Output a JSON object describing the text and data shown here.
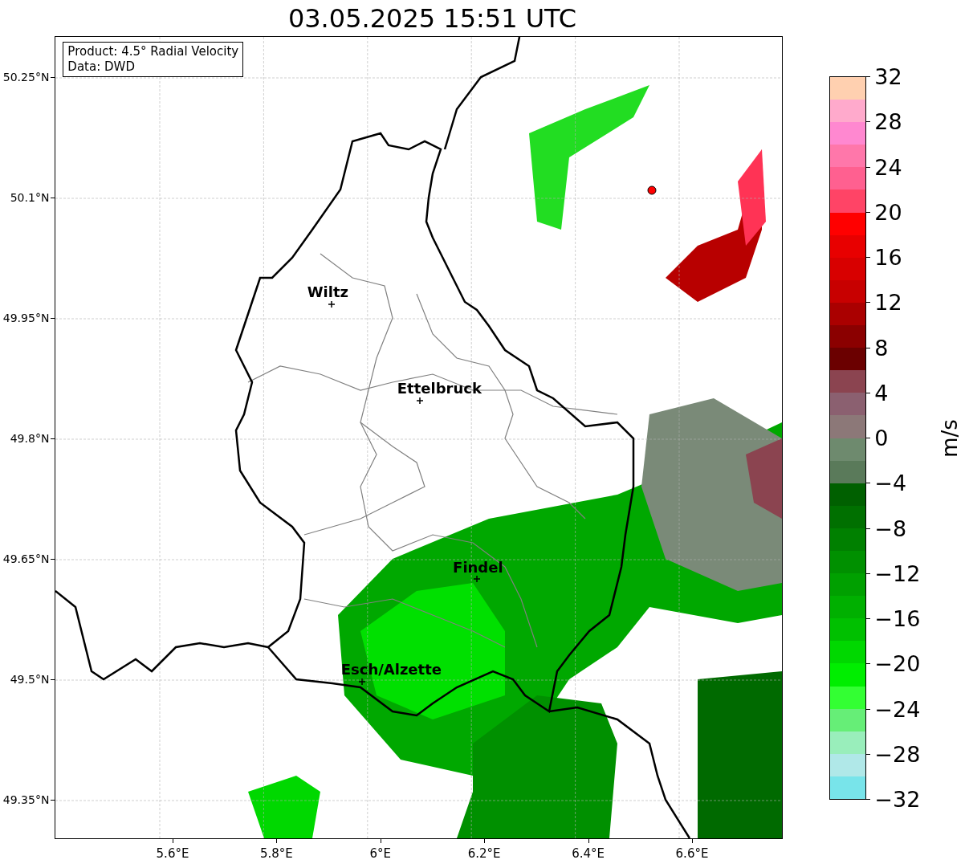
{
  "title": "03.05.2025 15:51 UTC",
  "info_box": {
    "lines": [
      "Product: 4.5° Radial Velocity",
      "Data: DWD"
    ]
  },
  "map": {
    "cities": [
      {
        "name": "Wiltz"
      },
      {
        "name": "Ettelbruck"
      },
      {
        "name": "Findel"
      },
      {
        "name": "Esch/Alzette"
      }
    ]
  },
  "latitude_ticks": [
    "50.25°N",
    "50.1°N",
    "49.95°N",
    "49.8°N",
    "49.65°N",
    "49.5°N",
    "49.35°N"
  ],
  "longitude_ticks": [
    "5.6°E",
    "5.8°E",
    "6°E",
    "6.2°E",
    "6.4°E",
    "6.6°E"
  ],
  "colorbar": {
    "label": "m/s",
    "ticks": [
      "32",
      "28",
      "24",
      "20",
      "16",
      "12",
      "8",
      "4",
      "0",
      "−4",
      "−8",
      "−12",
      "−16",
      "−20",
      "−24",
      "−28",
      "−32"
    ],
    "bands": [
      {
        "color": "#ffd0b0"
      },
      {
        "color": "#ffaacc"
      },
      {
        "color": "#ff88d0"
      },
      {
        "color": "#ff77aa"
      },
      {
        "color": "#ff6090"
      },
      {
        "color": "#ff4466"
      },
      {
        "color": "#ff0000"
      },
      {
        "color": "#e80000"
      },
      {
        "color": "#d80000"
      },
      {
        "color": "#c80000"
      },
      {
        "color": "#aa0000"
      },
      {
        "color": "#8b0000"
      },
      {
        "color": "#6b0000"
      },
      {
        "color": "#8b4450"
      },
      {
        "color": "#8b6070"
      },
      {
        "color": "#8c7878"
      },
      {
        "color": "#6e8a6e"
      },
      {
        "color": "#5a7a5a"
      },
      {
        "color": "#006000"
      },
      {
        "color": "#007000"
      },
      {
        "color": "#008000"
      },
      {
        "color": "#009000"
      },
      {
        "color": "#00a000"
      },
      {
        "color": "#00b000"
      },
      {
        "color": "#00c000"
      },
      {
        "color": "#00d800"
      },
      {
        "color": "#00ee00"
      },
      {
        "color": "#33ff33"
      },
      {
        "color": "#66ee77"
      },
      {
        "color": "#99eebb"
      },
      {
        "color": "#b0e8e8"
      },
      {
        "color": "#78e4ea"
      }
    ]
  }
}
